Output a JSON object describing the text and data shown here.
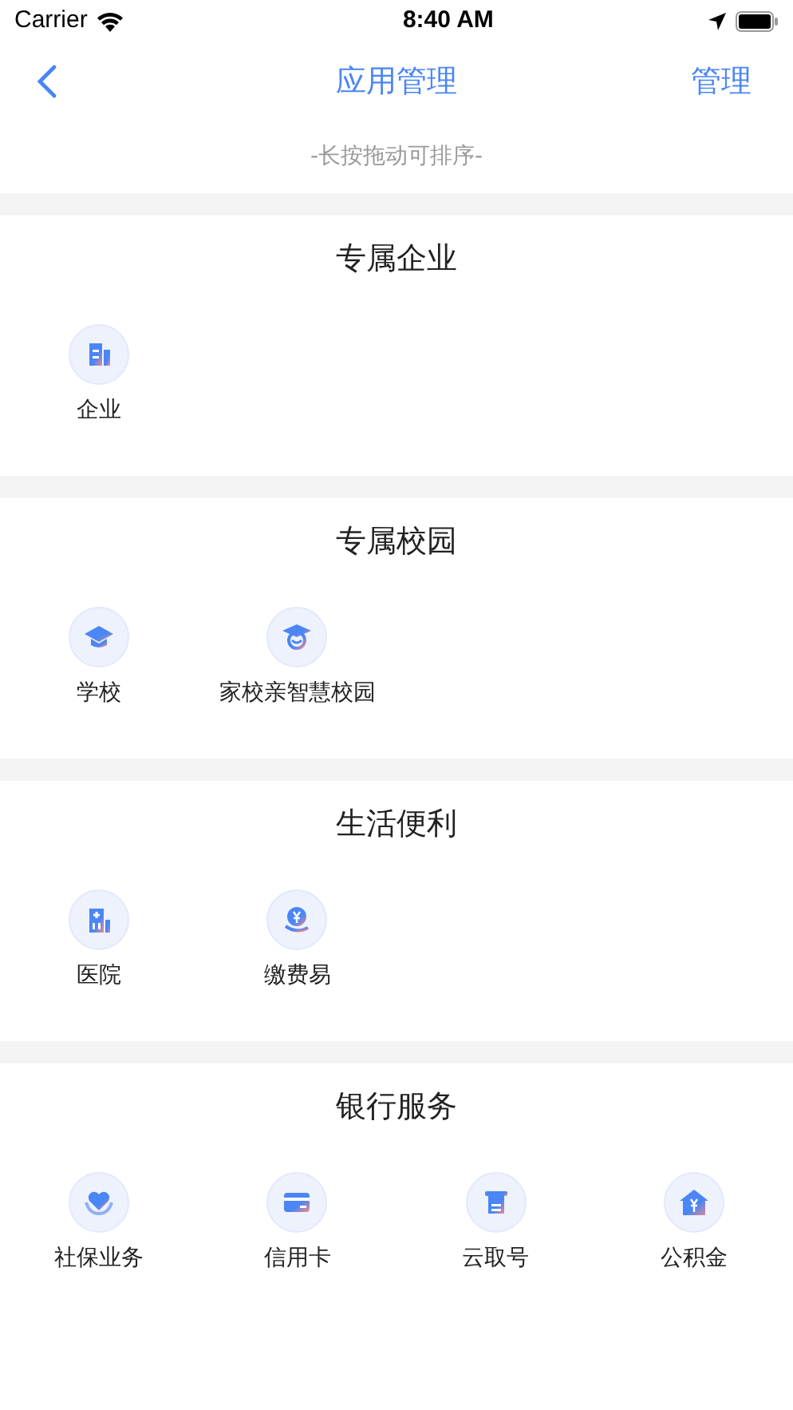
{
  "status_bar": {
    "carrier": "Carrier",
    "time": "8:40 AM"
  },
  "nav": {
    "title": "应用管理",
    "action": "管理"
  },
  "hint": "-长按拖动可排序-",
  "sections": [
    {
      "title": "专属企业",
      "apps": [
        {
          "label": "企业"
        }
      ]
    },
    {
      "title": "专属校园",
      "apps": [
        {
          "label": "学校"
        },
        {
          "label": "家校亲智慧校园"
        }
      ]
    },
    {
      "title": "生活便利",
      "apps": [
        {
          "label": "医院"
        },
        {
          "label": "缴费易"
        }
      ]
    },
    {
      "title": "银行服务",
      "apps": [
        {
          "label": "社保业务"
        },
        {
          "label": "信用卡"
        },
        {
          "label": "云取号"
        },
        {
          "label": "公积金"
        }
      ]
    }
  ]
}
